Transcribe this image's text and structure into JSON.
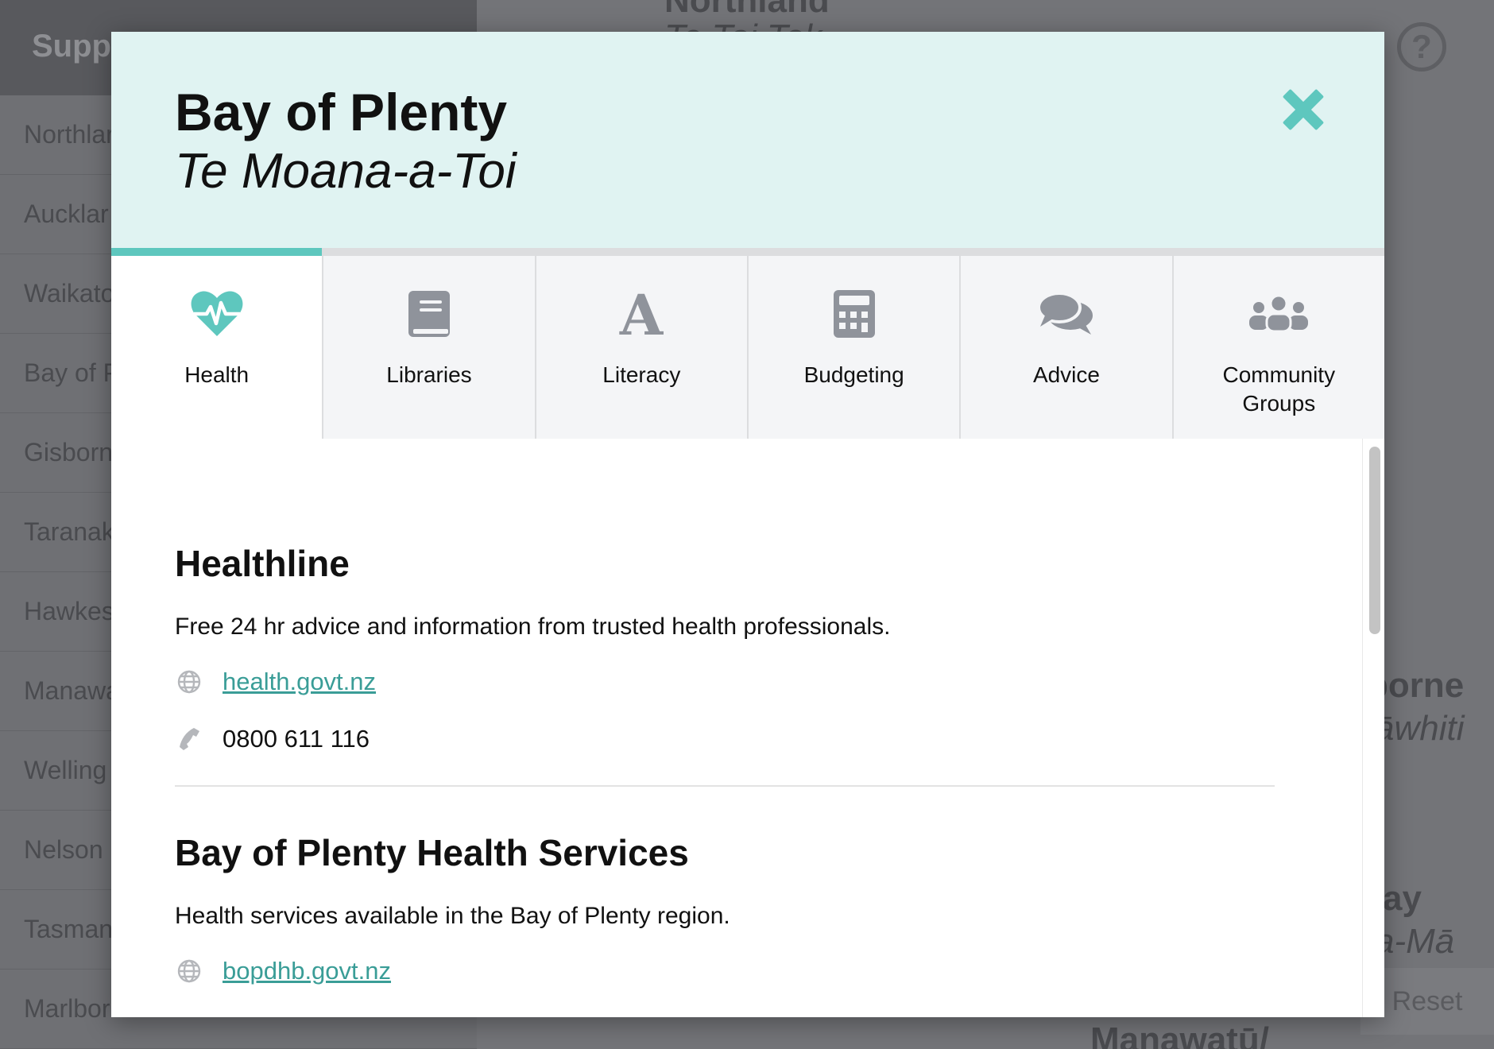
{
  "background": {
    "sidebar_header": "Suppo",
    "sidebar_items": [
      "Northlar",
      "Aucklar",
      "Waikato",
      "Bay of P",
      "Gisborn",
      "Taranak",
      "Hawkes",
      "Manawa",
      "Welling",
      "Nelson",
      "Tasman",
      "Marlbor"
    ],
    "map_labels": [
      {
        "text": "Northland",
        "italic": false
      },
      {
        "text": "Te Tai Tok",
        "italic": true
      },
      {
        "text": "borne",
        "italic": false
      },
      {
        "text": "āwhiti",
        "italic": true
      },
      {
        "text": "ay",
        "italic": false
      },
      {
        "text": "a-Mā",
        "italic": true
      },
      {
        "text": "Manawatū/",
        "italic": false
      }
    ],
    "help_glyph": "?",
    "reset_label": "Reset"
  },
  "modal": {
    "title": "Bay of Plenty",
    "subtitle": "Te Moana-a-Toi",
    "close_icon": "close-x-icon"
  },
  "tabs": [
    {
      "label": "Health",
      "icon": "heartbeat-icon",
      "active": true
    },
    {
      "label": "Libraries",
      "icon": "book-icon",
      "active": false
    },
    {
      "label": "Literacy",
      "icon": "letter-a-icon",
      "active": false
    },
    {
      "label": "Budgeting",
      "icon": "calculator-icon",
      "active": false
    },
    {
      "label": "Advice",
      "icon": "chat-bubbles-icon",
      "active": false
    },
    {
      "label": "Community Groups",
      "icon": "people-group-icon",
      "active": false
    }
  ],
  "services": [
    {
      "name": "Healthline",
      "description": "Free 24 hr advice and information from trusted health professionals.",
      "website": "health.govt.nz",
      "phone": "0800 611 116"
    },
    {
      "name": "Bay of Plenty Health Services",
      "description": "Health services available in the Bay of Plenty region.",
      "website": "bopdhb.govt.nz"
    }
  ],
  "colors": {
    "accent": "#5ec7be",
    "header_bg": "#e0f3f2",
    "link": "#3a9d97",
    "tab_icon_gray": "#8f939b"
  }
}
